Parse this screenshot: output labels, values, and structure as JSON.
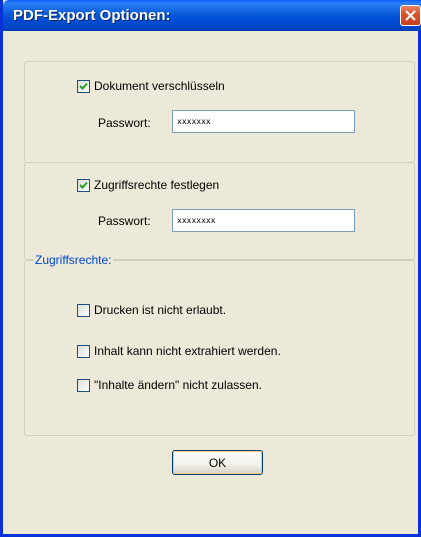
{
  "window": {
    "title": "PDF-Export Optionen:",
    "close_icon": "close-x-icon",
    "title_color": "#0a5ad9",
    "frame_color": "#0831d9"
  },
  "encryption": {
    "checkbox_label": "Dokument verschlüsseln",
    "checked": true,
    "password_label": "Passwort:",
    "password_value": "xxxxxxx"
  },
  "permissions_setup": {
    "checkbox_label": "Zugriffsrechte festlegen",
    "checked": true,
    "password_label": "Passwort:",
    "password_value": "xxxxxxxx"
  },
  "permissions": {
    "group_title": "Zugriffsrechte:",
    "items": [
      {
        "label": "Drucken ist nicht erlaubt.",
        "checked": false
      },
      {
        "label": "Inhalt kann nicht extrahiert werden.",
        "checked": false
      },
      {
        "label": "\"Inhalte ändern\" nicht zulassen.",
        "checked": false
      }
    ]
  },
  "buttons": {
    "ok_label": "OK"
  }
}
